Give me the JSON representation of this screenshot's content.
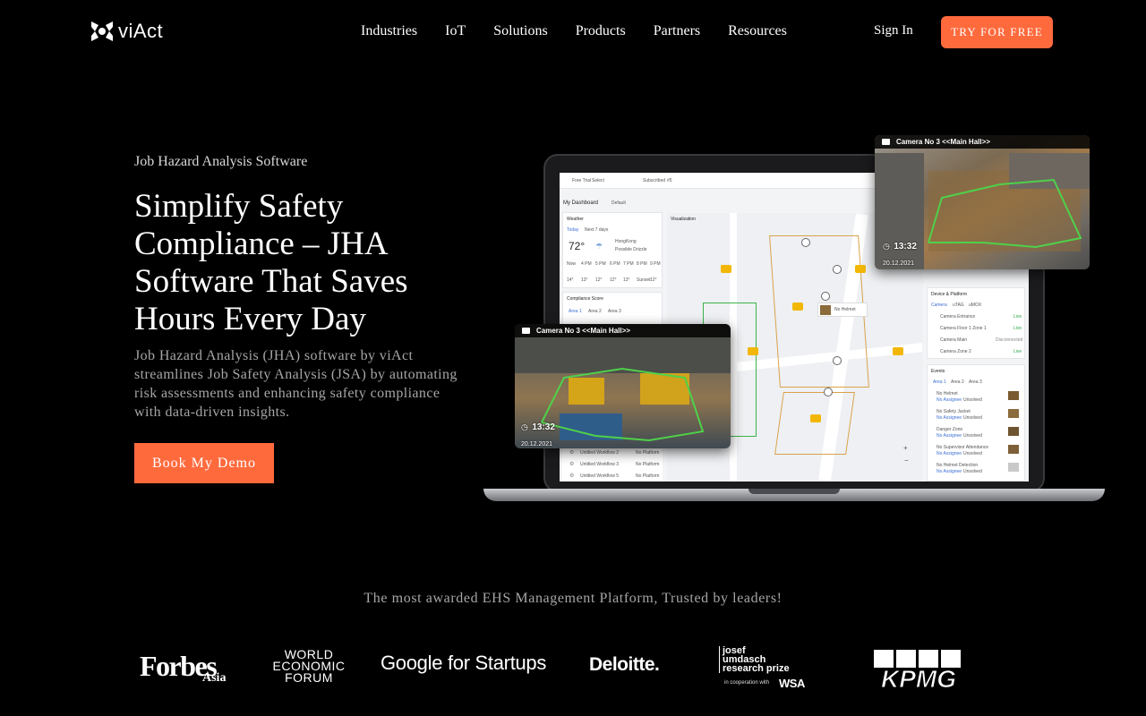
{
  "brand": {
    "name": "viAct"
  },
  "nav": {
    "links": [
      "Industries",
      "IoT",
      "Solutions",
      "Products",
      "Partners",
      "Resources"
    ],
    "sign_in": "Sign In",
    "cta": "TRY FOR FREE"
  },
  "hero": {
    "eyebrow": "Job Hazard Analysis Software",
    "headline": "Simplify Safety Compliance – JHA Software That Saves Hours Every Day",
    "description": "Job Hazard Analysis (JHA) software by viAct streamlines Job Safety Analysis (JSA) by automating risk assessments and enhancing safety compliance with data-driven insights.",
    "cta": "Book My Demo"
  },
  "mockup": {
    "topbar": {
      "free_trial": "Free Trial",
      "select": "Select",
      "subscribed": "Subscribed",
      "count": "#5"
    },
    "dashboard": {
      "title": "My Dashboard",
      "default": "Default"
    },
    "weather": {
      "title": "Weather",
      "tabs": [
        "Today",
        "Next 7 days"
      ],
      "temp": "72°",
      "location": "HongKong",
      "condition": "Possible Drizzle",
      "hours": [
        "Now",
        "4 PM",
        "5 PM",
        "6 PM",
        "7 PM",
        "8 PM",
        "9 PM"
      ],
      "temps": [
        "14°",
        "13°",
        "12°",
        "12°",
        "13°",
        "Sunset",
        "12°"
      ]
    },
    "compliance": {
      "title": "Compliance Score",
      "tabs": [
        "Area 1",
        "Area 2",
        "Area 3"
      ]
    },
    "visualization": {
      "title": "Visualization"
    },
    "map_alert": "No Helmet",
    "workflows": [
      {
        "name": "Untitled Workflow 2",
        "platform": "No Platform"
      },
      {
        "name": "Untitled Workflow 3",
        "platform": "No Platform"
      },
      {
        "name": "Untitled Workflow 5",
        "platform": "No Platform"
      }
    ],
    "device": {
      "title": "Device & Platform",
      "tabs": [
        "Camera",
        "uTAG",
        "uMOX"
      ],
      "rows": [
        {
          "name": "Camera Entrance",
          "status": "Live"
        },
        {
          "name": "Camera Floor 1 Zone 1",
          "status": "Live"
        },
        {
          "name": "Camera Main",
          "status": "Disconnected"
        },
        {
          "name": "Camera Zone 2",
          "status": "Live"
        }
      ]
    },
    "events": {
      "title": "Events",
      "tabs": [
        "Area 1",
        "Area 2",
        "Area 3"
      ],
      "items": [
        "No Helmet",
        "No Safety Jacket",
        "Danger Zone",
        "No Supervisor Attendance",
        "No Helmet Detection"
      ],
      "assignee": "No Assignee",
      "state": "Unsolved"
    },
    "cameras": [
      {
        "title": "Camera No 3 <<Main Hall>>",
        "time": "13:32",
        "date": "20.12.2021"
      },
      {
        "title": "Camera No 3 <<Main Hall>>",
        "time": "13:32",
        "date": "20.12.2021"
      }
    ]
  },
  "trust": {
    "heading": "The most awarded EHS Management Platform, Trusted by leaders!",
    "logos": {
      "forbes": "Forbes",
      "forbes_sub": "Asia",
      "wef": [
        "WORLD",
        "ECONOMIC",
        "FORUM"
      ],
      "google": "Google for Startups",
      "deloitte": "Deloitte.",
      "josef": [
        "josef",
        "umdasch",
        "research prize"
      ],
      "josef_sub": "in cooperation with",
      "wsa": "WSA",
      "kpmg": "KPMG"
    }
  },
  "colors": {
    "accent": "#ff6a3d",
    "background": "#000000",
    "muted_text": "#a6a6a6"
  }
}
